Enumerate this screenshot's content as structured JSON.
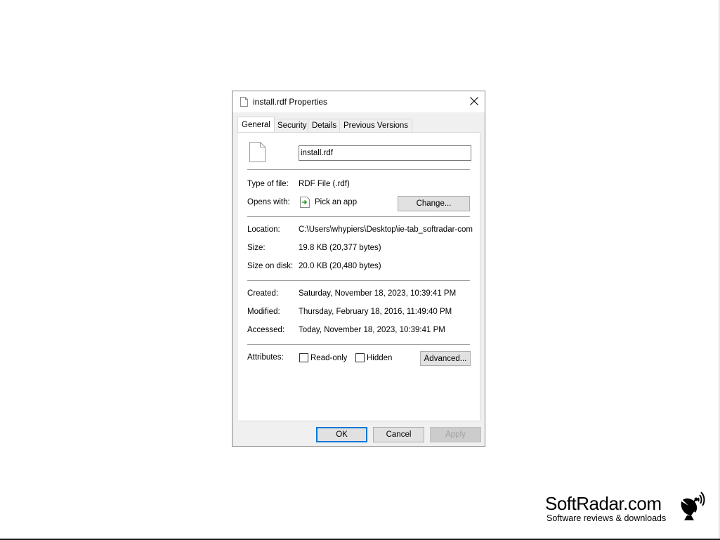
{
  "dialog": {
    "title": "install.rdf Properties",
    "tabs": [
      "General",
      "Security",
      "Details",
      "Previous Versions"
    ],
    "active_tab": "General",
    "file_name": "install.rdf",
    "type_of_file": {
      "label": "Type of file:",
      "value": "RDF File (.rdf)"
    },
    "opens_with": {
      "label": "Opens with:",
      "value": "Pick an app",
      "button": "Change..."
    },
    "location": {
      "label": "Location:",
      "value": "C:\\Users\\whypiers\\Desktop\\ie-tab_softradar-com"
    },
    "size": {
      "label": "Size:",
      "value": "19.8 KB (20,377 bytes)"
    },
    "size_on_disk": {
      "label": "Size on disk:",
      "value": "20.0 KB (20,480 bytes)"
    },
    "created": {
      "label": "Created:",
      "value": "Saturday, November 18, 2023, 10:39:41 PM"
    },
    "modified": {
      "label": "Modified:",
      "value": "Thursday, February 18, 2016, 11:49:40 PM"
    },
    "accessed": {
      "label": "Accessed:",
      "value": "Today, November 18, 2023, 10:39:41 PM"
    },
    "attributes": {
      "label": "Attributes:",
      "readonly": "Read-only",
      "hidden": "Hidden",
      "advanced": "Advanced..."
    },
    "buttons": {
      "ok": "OK",
      "cancel": "Cancel",
      "apply": "Apply"
    }
  },
  "watermark": {
    "brand": "SoftRadar.com",
    "tagline": "Software reviews & downloads"
  },
  "colors": {
    "accent": "#0078d7",
    "dialog_bg": "#f0f0f0"
  }
}
